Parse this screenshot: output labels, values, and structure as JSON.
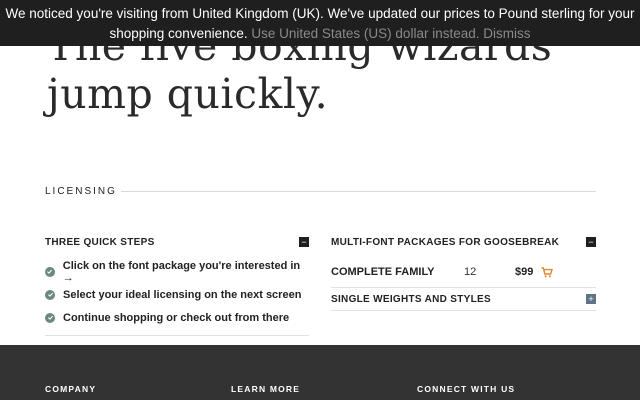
{
  "notice": {
    "message": "We noticed you're visiting from United Kingdom (UK). We've updated our prices to Pound sterling for your shopping convenience.",
    "use_usd_link": "Use United States (US) dollar instead.",
    "dismiss_link": "Dismiss"
  },
  "hero": {
    "line1": "The five boxing wizards",
    "line2": "jump quickly."
  },
  "licensing": {
    "heading": "LICENSING",
    "steps_panel": {
      "title": "THREE QUICK STEPS",
      "toggle": "−",
      "steps": [
        "Click on the font package you're interested in →",
        "Select your ideal licensing on the next screen",
        "Continue shopping or check out from there"
      ]
    },
    "packages_panel": {
      "title": "MULTI-FONT PACKAGES FOR GOOSEBREAK",
      "toggle": "−",
      "family": {
        "name": "COMPLETE FAMILY",
        "count": "12",
        "price": "$99",
        "icon": "cart-icon"
      },
      "single": {
        "title": "SINGLE WEIGHTS AND STYLES",
        "toggle": "+"
      }
    }
  },
  "footer": {
    "company": "COMPANY",
    "learn_more": "LEARN MORE",
    "connect": "CONNECT WITH US"
  },
  "colors": {
    "notice_bg": "#1f1f1f",
    "check_green": "#6b8a7a",
    "cart_orange": "#e0892b",
    "footer_bg": "#333333"
  }
}
